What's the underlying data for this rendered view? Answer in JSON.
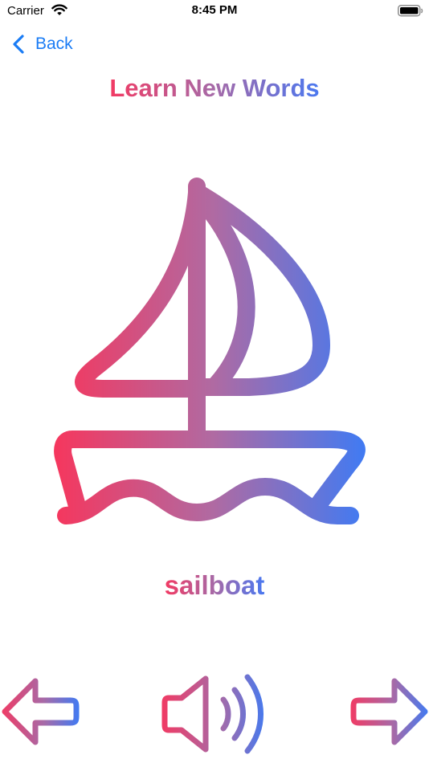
{
  "status_bar": {
    "carrier": "Carrier",
    "time": "8:45 PM"
  },
  "nav": {
    "back_label": "Back"
  },
  "title": "Learn New Words",
  "card": {
    "illustration_icon": "sailboat-icon",
    "word": "sailboat"
  },
  "controls": {
    "previous_icon": "arrow-left-icon",
    "speak_icon": "speaker-icon",
    "next_icon": "arrow-right-icon"
  },
  "colors": {
    "accent_blue": "#1a7cf5",
    "gradient_start": "#f23a63",
    "gradient_mid": "#a66aa8",
    "gradient_end": "#4a78f0"
  }
}
